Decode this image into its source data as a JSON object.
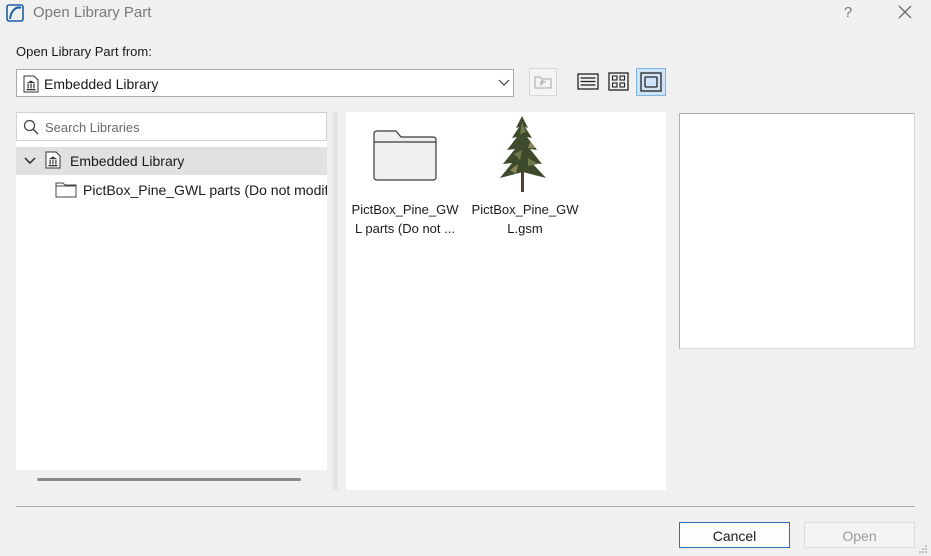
{
  "window": {
    "title": "Open Library Part",
    "help_label": "?"
  },
  "source": {
    "label": "Open Library Part from:",
    "selected": "Embedded Library"
  },
  "search": {
    "placeholder": "Search Libraries",
    "value": ""
  },
  "tree": {
    "root": "Embedded Library",
    "child": "PictBox_Pine_GWL parts (Do not modify"
  },
  "files": [
    {
      "name": "PictBox_Pine_GWL parts (Do not ...",
      "name_line1": "PictBox_Pine_GW",
      "name_line2": "L parts (Do not ...",
      "kind": "folder-icon"
    },
    {
      "name": "PictBox_Pine_GWL.gsm",
      "name_line1": "PictBox_Pine_GW",
      "name_line2": "L.gsm",
      "kind": "tree-thumbnail"
    }
  ],
  "buttons": {
    "cancel": "Cancel",
    "open": "Open"
  },
  "colors": {
    "accent": "#2c6fb8",
    "selected_view": "#cde3f7",
    "tree_selection": "#e1e1e1"
  }
}
